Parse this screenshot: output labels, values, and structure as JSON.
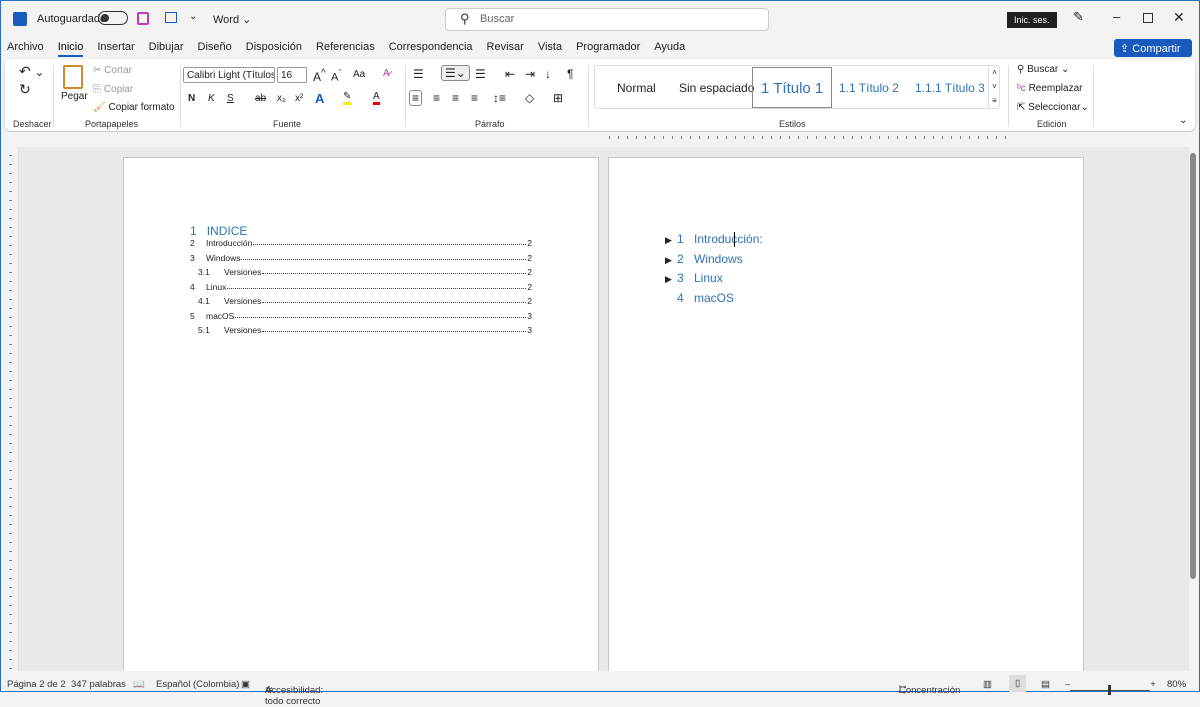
{
  "titlebar": {
    "autosave_label": "Autoguardado",
    "app_label": "Word",
    "search_placeholder": "Buscar",
    "signin_label": "Inic. ses."
  },
  "tabs": [
    "Archivo",
    "Inicio",
    "Insertar",
    "Dibujar",
    "Diseño",
    "Disposición",
    "Referencias",
    "Correspondencia",
    "Revisar",
    "Vista",
    "Programador",
    "Ayuda"
  ],
  "share_label": "Compartir",
  "ribbon": {
    "undo_group": "Deshacer",
    "clipboard": {
      "paste": "Pegar",
      "cut": "Cortar",
      "copy": "Copiar",
      "format_painter": "Copiar formato",
      "label": "Portapapeles"
    },
    "font": {
      "name": "Calibri Light (Títulos",
      "size": "16",
      "bold": "N",
      "italic": "K",
      "underline": "S",
      "label": "Fuente",
      "change_case": "Aa"
    },
    "paragraph": {
      "label": "Párrafo"
    },
    "styles": {
      "items": [
        "Normal",
        "Sin espaciado",
        "1  Título 1",
        "1.1  Título 2",
        "1.1.1  Título 3"
      ],
      "label": "Estilos"
    },
    "editing": {
      "find": "Buscar",
      "replace": "Reemplazar",
      "select": "Seleccionar",
      "label": "Edición"
    }
  },
  "page1": {
    "heading_num": "1",
    "heading": "INDICE",
    "toc": [
      {
        "num": "2",
        "text": "Introducción",
        "page": "2",
        "level": 1
      },
      {
        "num": "3",
        "text": "Windows",
        "page": "2",
        "level": 1
      },
      {
        "num": "3.1",
        "text": "Versiones",
        "page": "2",
        "level": 2
      },
      {
        "num": "4",
        "text": "Linux",
        "page": "2",
        "level": 1
      },
      {
        "num": "4.1",
        "text": "Versiones",
        "page": "2",
        "level": 2
      },
      {
        "num": "5",
        "text": "macOS",
        "page": "3",
        "level": 1
      },
      {
        "num": "5.1",
        "text": "Versiones",
        "page": "3",
        "level": 2
      }
    ]
  },
  "page2": {
    "headings": [
      {
        "num": "1",
        "text": "Introducción:",
        "collapsible": true
      },
      {
        "num": "2",
        "text": "Windows",
        "collapsible": true
      },
      {
        "num": "3",
        "text": "Linux",
        "collapsible": true
      },
      {
        "num": "4",
        "text": "macOS",
        "collapsible": false
      }
    ]
  },
  "status": {
    "page": "Página 2 de 2",
    "words": "347 palabras",
    "language": "Español (Colombia)",
    "accessibility": "Accesibilidad: todo correcto",
    "focus": "Concentración",
    "zoom": "80%"
  },
  "colors": {
    "accent": "#185abd",
    "heading": "#2e74b5"
  }
}
